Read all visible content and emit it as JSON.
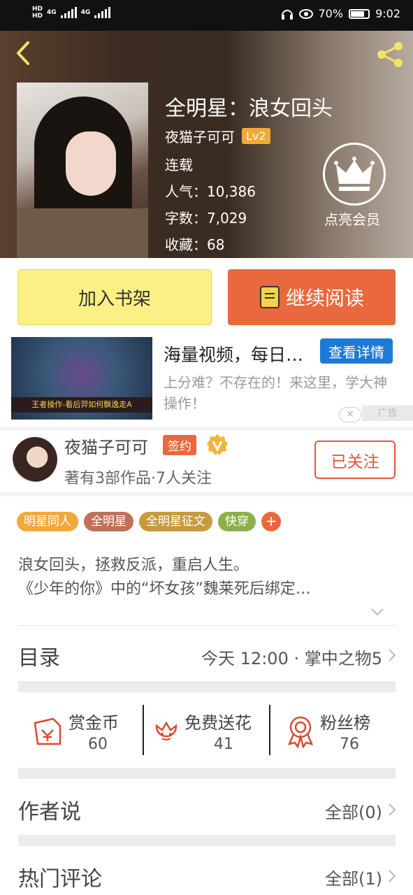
{
  "status_bar": {
    "network_1": "HD",
    "network_2": "HD",
    "signal_1": "4G",
    "signal_2": "4G",
    "battery": "70%",
    "time": "9:02"
  },
  "book": {
    "title": "全明星：浪女回头",
    "author": "夜猫子可可",
    "author_level": "Lv2",
    "status": "连载",
    "popularity_label": "人气：",
    "popularity": "10,386",
    "words_label": "字数：",
    "words": "7,029",
    "favorites_label": "收藏：",
    "favorites": "68",
    "vip_label": "点亮会员"
  },
  "actions": {
    "add_shelf": "加入书架",
    "continue_read": "继续阅读"
  },
  "ad": {
    "title": "海量视频，每日…",
    "detail_button": "查看详情",
    "desc": "上分难？不存在的！来这里，学大神操作！",
    "image_caption": "王者操作-看后羿如何飘逸走A",
    "close": "✕",
    "tag": "广告"
  },
  "author_card": {
    "name": "夜猫子可可",
    "badge": "签约",
    "sub": "著有3部作品·7人关注",
    "follow": "已关注"
  },
  "tags": [
    {
      "label": "明星同人",
      "color": "#f2a93b"
    },
    {
      "label": "全明星",
      "color": "#c0715a"
    },
    {
      "label": "全明星征文",
      "color": "#c79a3d"
    },
    {
      "label": "快穿",
      "color": "#8bb04a"
    }
  ],
  "tag_more": "+",
  "description": {
    "line1": "浪女回头，拯救反派，重启人生。",
    "line2": "《少年的你》中的“坏女孩”魏莱死后绑定…"
  },
  "catalog": {
    "title": "目录",
    "latest": "今天 12:00 · 掌中之物5"
  },
  "rewards": [
    {
      "label": "赏金币",
      "value": "60"
    },
    {
      "label": "免费送花",
      "value": "41"
    },
    {
      "label": "粉丝榜",
      "value": "76"
    }
  ],
  "author_says": {
    "title": "作者说",
    "all": "全部(0)"
  },
  "hot_comments": {
    "title": "热门评论",
    "all": "全部(1)"
  },
  "colors": {
    "accent": "#e9683d",
    "shelf_button": "#fbef86",
    "follow_red": "#e5533d",
    "ad_blue": "#1f7ad6"
  }
}
